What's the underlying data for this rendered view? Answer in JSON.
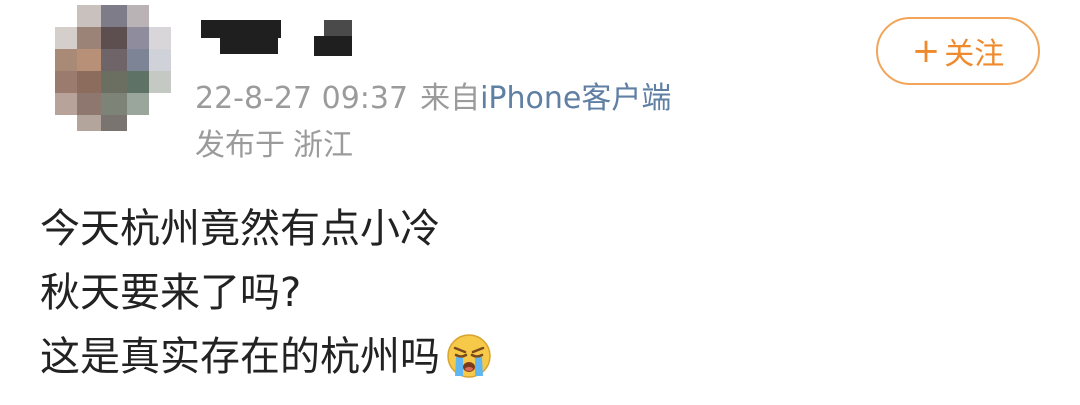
{
  "user": {
    "avatar_icon": "blurred-avatar-icon",
    "name_redacted": true
  },
  "post_meta": {
    "date_time": "22-8-27 09:37",
    "source_prefix": "来自",
    "source_name": "iPhone客户端",
    "location_label": "发布于",
    "location": "浙江"
  },
  "follow_button": {
    "icon": "plus-icon",
    "plus": "+",
    "label": "关注",
    "color": "#ef8a2c"
  },
  "post": {
    "lines": [
      "今天杭州竟然有点小冷",
      "秋天要来了吗?",
      "这是真实存在的杭州吗"
    ],
    "trailing_emoji": "crying-face-emoji"
  }
}
